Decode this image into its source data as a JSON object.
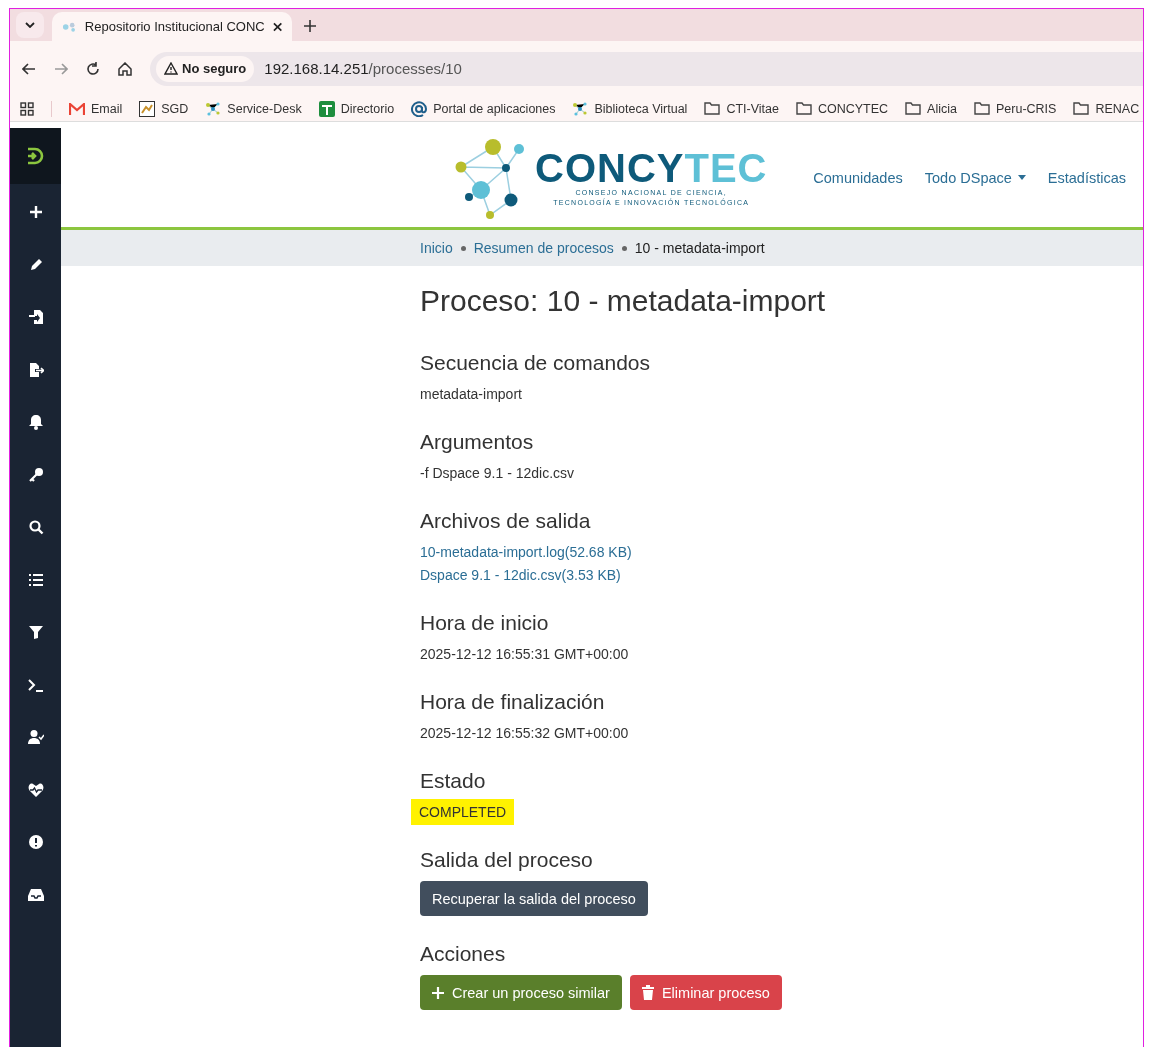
{
  "browser": {
    "tab": {
      "title": "Repositorio Institucional CONC",
      "selected": true
    },
    "address": {
      "security": "No seguro",
      "host": "192.168.14.251",
      "path": "/processes/10"
    },
    "bookmarks": [
      {
        "label": "Email",
        "kind": "mail"
      },
      {
        "label": "SGD",
        "kind": "app"
      },
      {
        "label": "Service-Desk",
        "kind": "network"
      },
      {
        "label": "Directorio",
        "kind": "directory"
      },
      {
        "label": "Portal de aplicaciones",
        "kind": "at"
      },
      {
        "label": "Biblioteca Virtual",
        "kind": "network"
      },
      {
        "label": "CTI-Vitae",
        "kind": "folder"
      },
      {
        "label": "CONCYTEC",
        "kind": "folder"
      },
      {
        "label": "Alicia",
        "kind": "folder"
      },
      {
        "label": "Peru-CRIS",
        "kind": "folder"
      },
      {
        "label": "RENAC",
        "kind": "folder"
      }
    ]
  },
  "sidebar": {
    "items": [
      {
        "kind": "plus"
      },
      {
        "kind": "pencil"
      },
      {
        "kind": "import"
      },
      {
        "kind": "export"
      },
      {
        "kind": "bell"
      },
      {
        "kind": "key"
      },
      {
        "kind": "search"
      },
      {
        "kind": "list"
      },
      {
        "kind": "filter"
      },
      {
        "kind": "terminal"
      },
      {
        "kind": "user-check"
      },
      {
        "kind": "heartbeat"
      },
      {
        "kind": "alert"
      },
      {
        "kind": "inbox"
      }
    ]
  },
  "header": {
    "logo": {
      "name_part_1": "CONCY",
      "name_part_2": "TEC",
      "tagline_1": "CONSEJO NACIONAL DE CIENCIA,",
      "tagline_2": "TECNOLOGÍA E INNOVACIÓN TECNOLÓGICA"
    },
    "nav": [
      {
        "label": "Comunidades",
        "dropdown": false
      },
      {
        "label": "Todo DSpace",
        "dropdown": true
      },
      {
        "label": "Estadísticas",
        "dropdown": false
      }
    ]
  },
  "breadcrumb": [
    {
      "label": "Inicio",
      "current": false
    },
    {
      "label": "Resumen de procesos",
      "current": false
    },
    {
      "label": "10 - metadata-import",
      "current": true
    }
  ],
  "title": "Proceso: 10 - metadata-import",
  "sections": [
    {
      "heading": "Secuencia de comandos",
      "kind": "text",
      "values": [
        "metadata-import"
      ],
      "highlighted": false
    },
    {
      "heading": "Argumentos",
      "kind": "text",
      "values": [
        "-f Dspace 9.1 - 12dic.csv"
      ],
      "highlighted": false
    },
    {
      "heading": "Archivos de salida",
      "kind": "links",
      "values": [
        "10-metadata-import.log(52.68 KB)",
        "Dspace 9.1 - 12dic.csv(3.53 KB)"
      ],
      "highlighted": false
    },
    {
      "heading": "Hora de inicio",
      "kind": "text",
      "values": [
        "2025-12-12 16:55:31 GMT+00:00"
      ],
      "highlighted": false
    },
    {
      "heading": "Hora de finalización",
      "kind": "text",
      "values": [
        "2025-12-12 16:55:32 GMT+00:00"
      ],
      "highlighted": false
    },
    {
      "heading": "Estado",
      "kind": "text",
      "values": [
        "COMPLETED"
      ],
      "highlighted": true
    }
  ],
  "output": {
    "heading": "Salida del proceso",
    "button": "Recuperar la salida del proceso"
  },
  "actions": {
    "heading": "Acciones",
    "buttons": [
      {
        "label": "Crear un proceso similar",
        "kind": "create"
      },
      {
        "label": "Eliminar proceso",
        "kind": "delete"
      }
    ]
  }
}
